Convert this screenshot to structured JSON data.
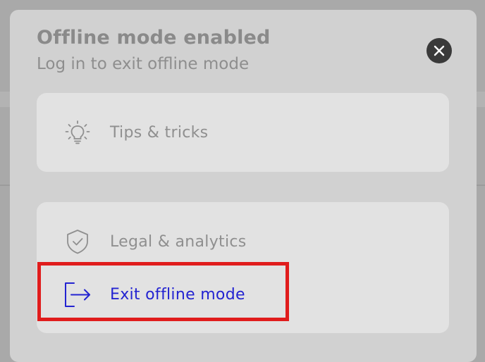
{
  "header": {
    "title": "Offline mode enabled",
    "subtitle": "Log in to exit offline mode"
  },
  "close_icon": "close-icon",
  "menu": {
    "tips": {
      "label": "Tips & tricks",
      "icon": "lightbulb-icon"
    },
    "legal": {
      "label": "Legal & analytics",
      "icon": "shield-check-icon"
    },
    "exit": {
      "label": "Exit offline mode",
      "icon": "exit-arrow-icon"
    }
  },
  "colors": {
    "accent": "#2323d1",
    "highlight": "#e01c1c",
    "muted_text": "#8f8f8f"
  }
}
